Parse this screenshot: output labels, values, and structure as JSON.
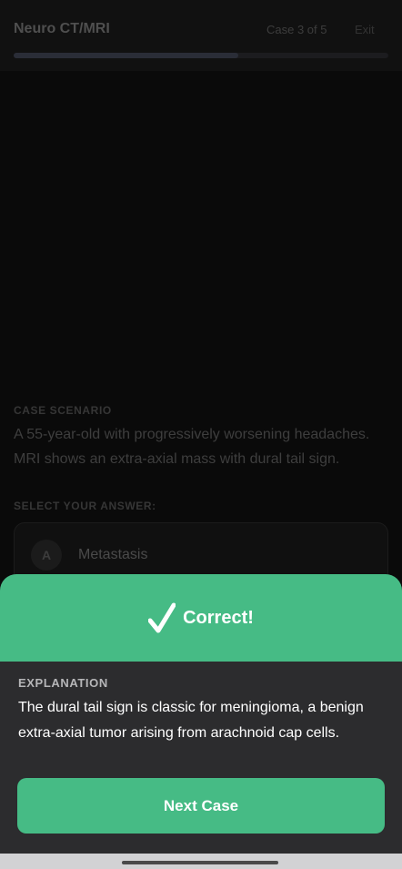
{
  "header": {
    "title": "Neuro CT/MRI",
    "case_counter": "Case 3 of 5",
    "exit_label": "Exit",
    "progress": 0.6
  },
  "scenario": {
    "label": "CASE SCENARIO",
    "text": "A 55-year-old with progressively worsening headaches. MRI shows an extra-axial mass with dural tail sign."
  },
  "answers": {
    "label": "SELECT YOUR ANSWER:",
    "options": [
      {
        "letter": "A",
        "text": "Metastasis"
      }
    ]
  },
  "feedback": {
    "result": "Correct!",
    "explanation_label": "EXPLANATION",
    "explanation": "The dural tail sign is classic for meningioma, a benign extra-axial tumor arising from arachnoid cap cells.",
    "next_label": "Next Case"
  },
  "colors": {
    "accent": "#46bb85",
    "sheet": "#2c2c2e",
    "background": "#0a0a0a"
  },
  "icons": {
    "result": "checkmark-icon"
  }
}
